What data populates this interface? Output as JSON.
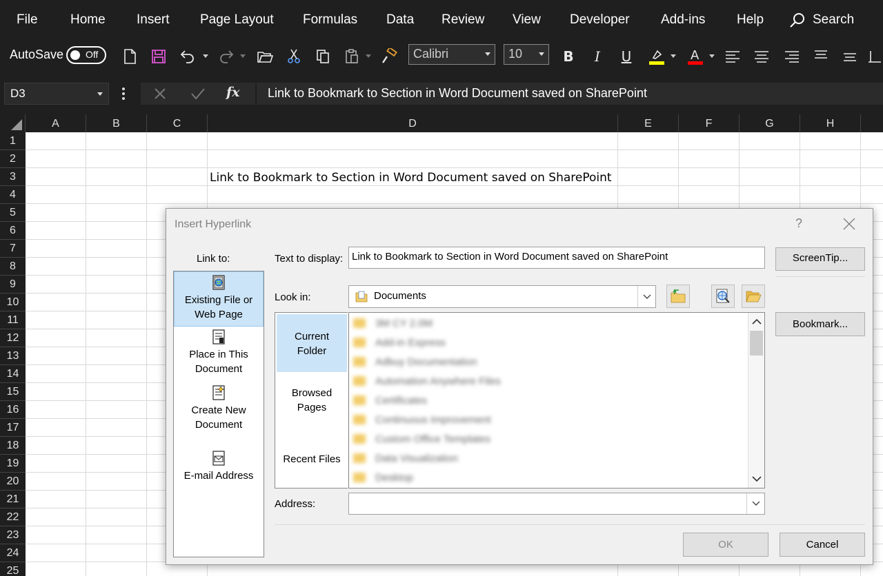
{
  "menu": {
    "items": [
      "File",
      "Home",
      "Insert",
      "Page Layout",
      "Formulas",
      "Data",
      "Review",
      "View",
      "Developer",
      "Add-ins",
      "Help"
    ],
    "search_label": "Search"
  },
  "toolbar": {
    "autosave_label": "AutoSave",
    "autosave_state": "Off",
    "font_name": "Calibri",
    "font_size": "10",
    "highlight_color": "#ffff00",
    "font_color": "#ff0000"
  },
  "formula_bar": {
    "name_box": "D3",
    "fx_label": "fx",
    "content": "Link to Bookmark to Section in Word Document saved on SharePoint"
  },
  "grid": {
    "columns": [
      "A",
      "B",
      "C",
      "D",
      "E",
      "F",
      "G",
      "H"
    ],
    "rows": [
      "1",
      "2",
      "3",
      "4",
      "5",
      "6",
      "7",
      "8",
      "9",
      "10",
      "11",
      "12",
      "13",
      "14",
      "15",
      "16",
      "17",
      "18",
      "19",
      "20",
      "21",
      "22",
      "23",
      "24",
      "25"
    ],
    "cell_d3": "Link to Bookmark to Section in Word Document saved on SharePoint"
  },
  "dialog": {
    "title": "Insert Hyperlink",
    "help": "?",
    "link_to_label": "Link to:",
    "link_to_items": [
      {
        "line1": "Existing File or",
        "line2": "Web Page"
      },
      {
        "line1": "Place in This",
        "line2": "Document"
      },
      {
        "line1": "Create New",
        "line2": "Document"
      },
      {
        "line1": "E-mail Address",
        "line2": ""
      }
    ],
    "text_to_display_label": "Text to display:",
    "text_to_display_value": "Link to Bookmark to Section in Word Document saved on SharePoint",
    "screentip_label": "ScreenTip...",
    "look_in_label": "Look in:",
    "look_in_value": "Documents",
    "places": [
      {
        "line1": "Current",
        "line2": "Folder"
      },
      {
        "line1": "Browsed",
        "line2": "Pages"
      },
      {
        "line1": "Recent Files",
        "line2": ""
      }
    ],
    "files": [
      "3M CY 2.0M",
      "Add-in Express",
      "Adbuy Documentation",
      "Automation Anywhere Files",
      "Certificates",
      "Continuous Improvement",
      "Custom Office Templates",
      "Data Visualization",
      "Desktop"
    ],
    "bookmark_label": "Bookmark...",
    "address_label": "Address:",
    "address_value": "",
    "ok_label": "OK",
    "cancel_label": "Cancel"
  }
}
